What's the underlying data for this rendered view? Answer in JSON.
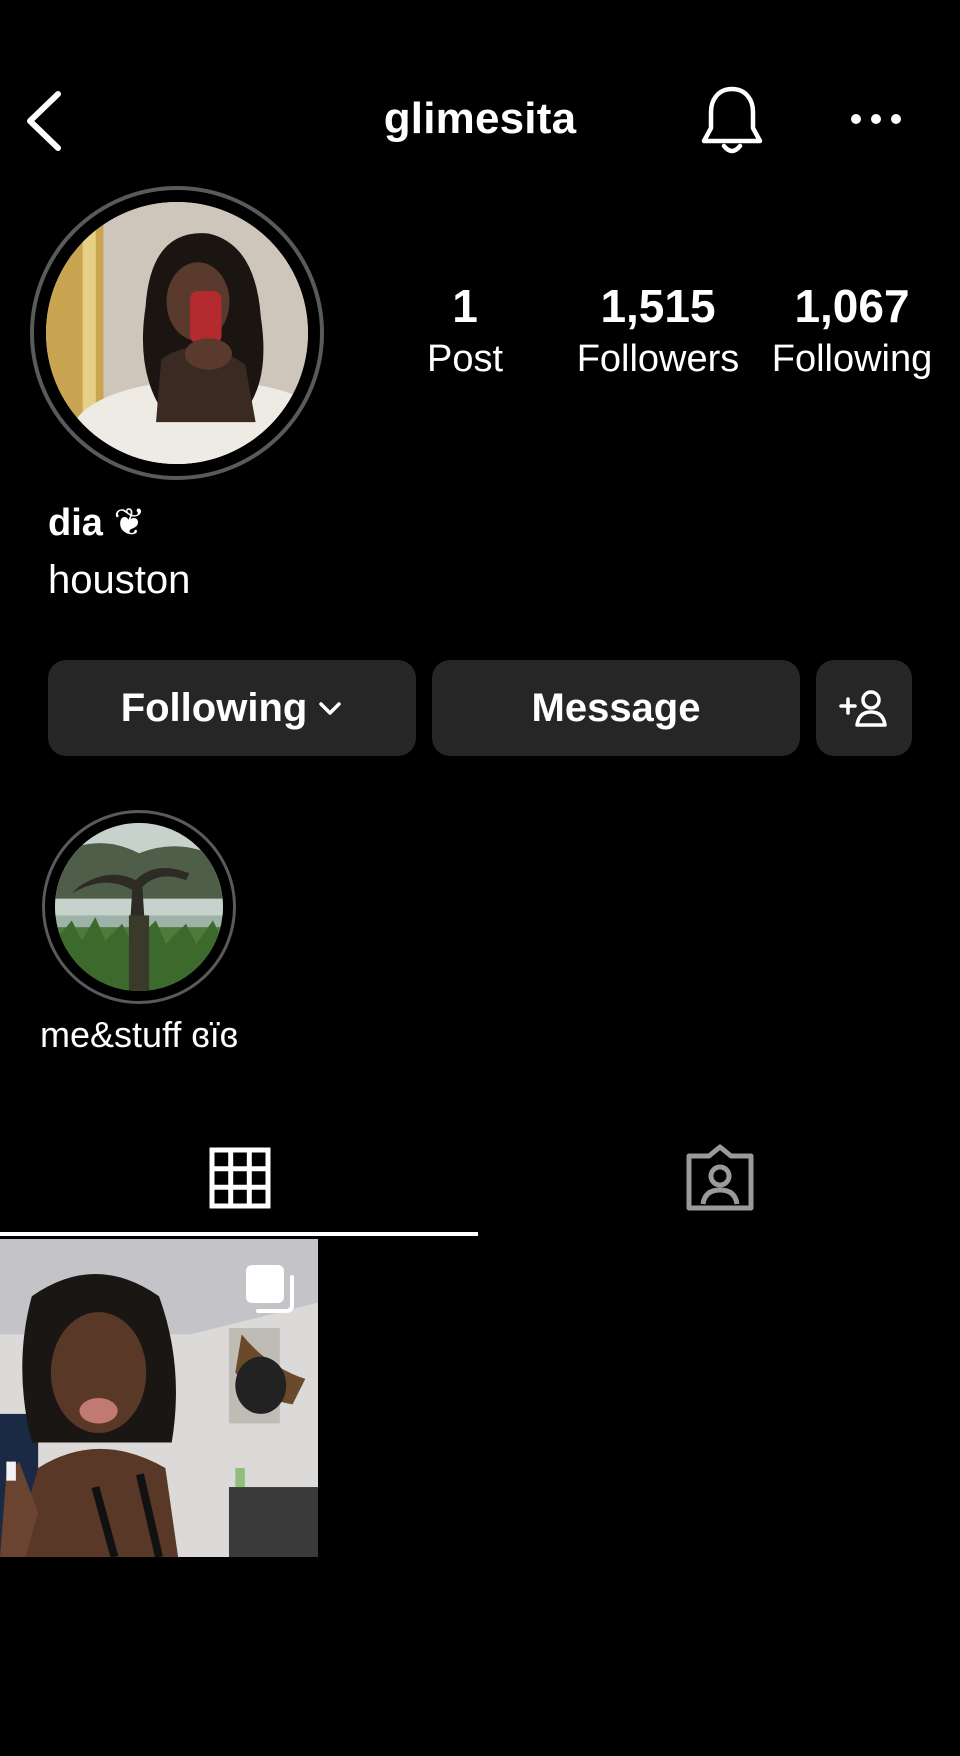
{
  "header": {
    "username": "glimesita",
    "back_icon": "chevron-left-icon",
    "bell_icon": "bell-icon",
    "more_icon": "ellipsis-icon"
  },
  "profile": {
    "display_name": "dia ❦",
    "bio": "houston"
  },
  "stats": {
    "posts": {
      "count": "1",
      "label": "Post"
    },
    "followers": {
      "count": "1,515",
      "label": "Followers"
    },
    "following": {
      "count": "1,067",
      "label": "Following"
    }
  },
  "actions": {
    "following_label": "Following",
    "message_label": "Message",
    "add_user_icon": "add-person-icon"
  },
  "highlights": [
    {
      "label": "me&stuff ɞïɞ"
    }
  ],
  "tabs": [
    {
      "name": "posts",
      "icon": "grid-icon",
      "active": true
    },
    {
      "name": "tagged",
      "icon": "tagged-person-icon",
      "active": false
    }
  ],
  "posts": [
    {
      "multiple": true,
      "icon": "carousel-icon"
    }
  ],
  "colors": {
    "background": "#000000",
    "button": "#262626",
    "ring": "#5a5a5a",
    "text": "#ffffff"
  }
}
